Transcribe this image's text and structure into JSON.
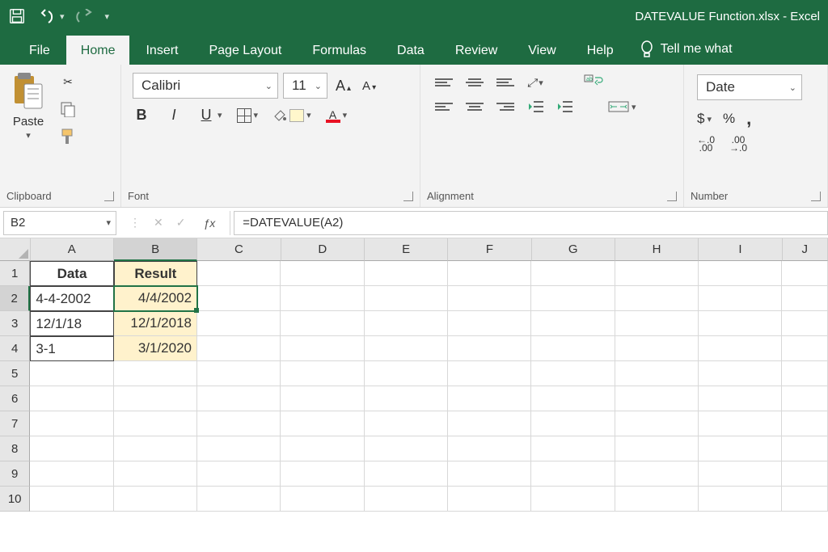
{
  "title": "DATEVALUE Function.xlsx  -  Excel",
  "tabs": {
    "file": "File",
    "home": "Home",
    "insert": "Insert",
    "layout": "Page Layout",
    "formulas": "Formulas",
    "data": "Data",
    "review": "Review",
    "view": "View",
    "help": "Help",
    "tell": "Tell me what"
  },
  "ribbon": {
    "clipboard": {
      "paste": "Paste",
      "label": "Clipboard"
    },
    "font": {
      "name": "Calibri",
      "size": "11",
      "label": "Font"
    },
    "alignment": {
      "label": "Alignment"
    },
    "number": {
      "format": "Date",
      "label": "Number",
      "dollar": "$",
      "percent": "%",
      "comma": ","
    }
  },
  "fbar": {
    "name": "B2",
    "formula": "=DATEVALUE(A2)"
  },
  "columns": [
    "A",
    "B",
    "C",
    "D",
    "E",
    "F",
    "G",
    "H",
    "I",
    "J"
  ],
  "rows": [
    "1",
    "2",
    "3",
    "4",
    "5",
    "6",
    "7",
    "8",
    "9",
    "10"
  ],
  "data": {
    "A1": "Data",
    "B1": "Result",
    "A2": "4-4-2002",
    "B2": "4/4/2002",
    "A3": "12/1/18",
    "B3": "12/1/2018",
    "A4": "3-1",
    "B4": "3/1/2020"
  }
}
